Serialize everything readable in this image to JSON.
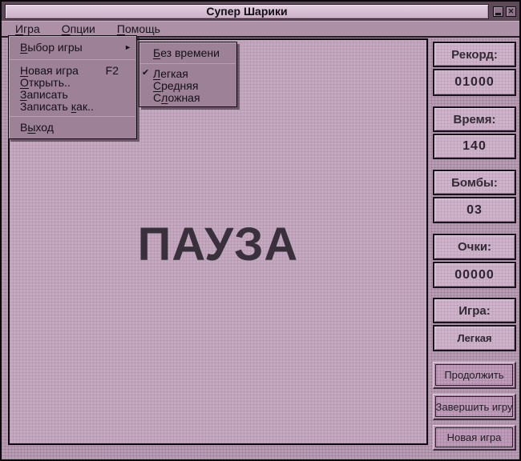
{
  "window": {
    "title": "Супер Шарики"
  },
  "icons": {
    "close_glyph": "✕",
    "checkmark_glyph": "✔",
    "submenu_arrow_glyph": "►"
  },
  "menubar": {
    "items": [
      {
        "pre": "",
        "hot": "И",
        "post": "гра"
      },
      {
        "pre": "",
        "hot": "О",
        "post": "пции"
      },
      {
        "pre": "",
        "hot": "П",
        "post": "омощь"
      }
    ]
  },
  "game_menu": {
    "items": [
      {
        "pre": "",
        "hot": "В",
        "post": "ыбор игры"
      },
      {
        "pre": "",
        "hot": "Н",
        "post": "овая игра",
        "shortcut": "F2"
      },
      {
        "pre": "",
        "hot": "О",
        "post": "ткрыть.."
      },
      {
        "pre": "",
        "hot": "З",
        "post": "аписать"
      },
      {
        "pre": "Записать ",
        "hot": "к",
        "post": "ак.."
      },
      {
        "pre": "В",
        "hot": "ы",
        "post": "ход"
      }
    ],
    "submenu": {
      "items": [
        {
          "pre": "",
          "hot": "Б",
          "post": "ез времени"
        },
        {
          "pre": "",
          "hot": "Л",
          "post": "егкая",
          "checked": true
        },
        {
          "pre": "",
          "hot": "С",
          "post": "редняя"
        },
        {
          "pre": "С",
          "hot": "л",
          "post": "ожная"
        }
      ]
    }
  },
  "game": {
    "pause_text": "ПАУЗА"
  },
  "sidebar": {
    "stats": [
      {
        "label": "Рекорд:",
        "value": "01000"
      },
      {
        "label": "Время:",
        "value": "140"
      },
      {
        "label": "Бомбы:",
        "value": "03"
      },
      {
        "label": "Очки:",
        "value": "00000"
      },
      {
        "label": "Игра:",
        "value": "Легкая"
      }
    ],
    "buttons": [
      {
        "label": "Продолжить"
      },
      {
        "label": "Завершить игру"
      },
      {
        "label": "Новая игра"
      }
    ]
  },
  "colors": {
    "window_body": "#b89cb4",
    "field": "#c5a9c1",
    "panel": "#cfb3cb",
    "menu": "#9c8197",
    "titlebar_inset": "#d8c0d4",
    "text": "#18121a"
  }
}
